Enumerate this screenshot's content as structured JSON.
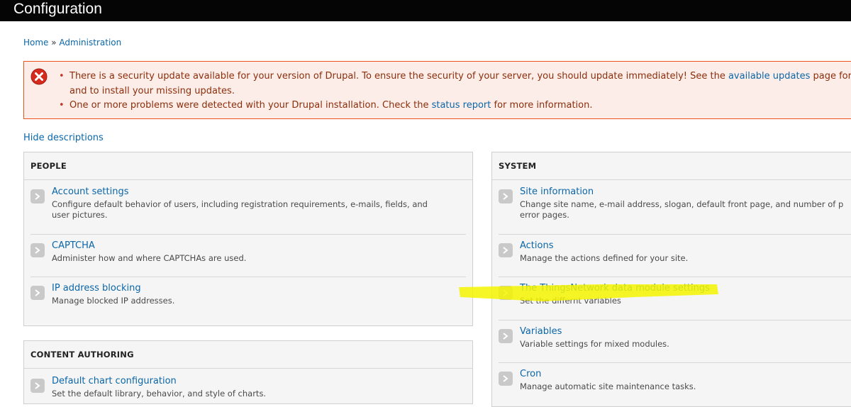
{
  "header": {
    "title": "Configuration"
  },
  "breadcrumb": {
    "home": "Home",
    "separator": " » ",
    "admin": "Administration"
  },
  "messages": {
    "line1_a": "There is a security update available for your version of Drupal. To ensure the security of your server, you should update immediately! See the ",
    "line1_link": "available updates",
    "line1_b": " page for mo",
    "line1_c": "and to install your missing updates.",
    "line2_a": "One or more problems were detected with your Drupal installation. Check the ",
    "line2_link": "status report",
    "line2_b": " for more information."
  },
  "hide_descriptions": "Hide descriptions",
  "people": {
    "title": "PEOPLE",
    "items": [
      {
        "title": "Account settings",
        "desc1": "Configure default behavior of users, including registration requirements, e-mails, fields, and",
        "desc2": "user pictures."
      },
      {
        "title": "CAPTCHA",
        "desc1": "Administer how and where CAPTCHAs are used."
      },
      {
        "title": "IP address blocking",
        "desc1": "Manage blocked IP addresses."
      }
    ]
  },
  "content_authoring": {
    "title": "CONTENT AUTHORING",
    "items": [
      {
        "title": "Default chart configuration",
        "desc1": "Set the default library, behavior, and style of charts."
      }
    ]
  },
  "system": {
    "title": "SYSTEM",
    "items": [
      {
        "title": "Site information",
        "desc1": "Change site name, e-mail address, slogan, default front page, and number of p",
        "desc2": "error pages."
      },
      {
        "title": "Actions",
        "desc1": "Manage the actions defined for your site."
      },
      {
        "title": "The ThingsNetwork data module settings",
        "desc1": "Set the differnt variables"
      },
      {
        "title": "Variables",
        "desc1": "Variable settings for mixed modules."
      },
      {
        "title": "Cron",
        "desc1": "Manage automatic site maintenance tasks."
      }
    ]
  },
  "colors": {
    "link": "#0b66a8",
    "error_bg": "#fcede9",
    "error_border": "#ed541d",
    "error_text": "#8c2e0b",
    "highlight": "#f5f500"
  },
  "icons": {
    "error": "error-x-icon",
    "arrow": "chevron-right-icon"
  }
}
